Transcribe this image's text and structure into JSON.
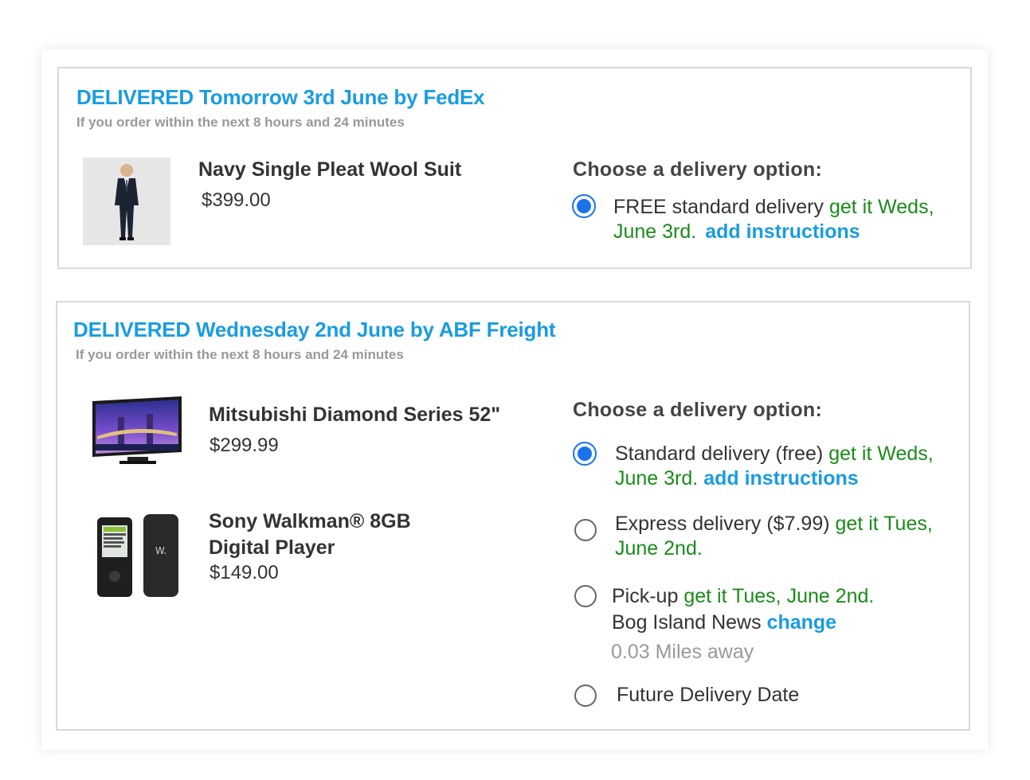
{
  "shipments": [
    {
      "heading": "DELIVERED Tomorrow 3rd June by FedEx",
      "subheading": "If you order within the next 8 hours and 24 minutes",
      "choose_label": "Choose a delivery option:",
      "products": [
        {
          "name": "Navy Single Pleat Wool Suit",
          "price": "$399.00"
        }
      ],
      "options": [
        {
          "selected": true,
          "label": "FREE standard delivery",
          "eta_line1": "get it Weds,",
          "eta_line2": "June 3rd.",
          "link": "add instructions"
        }
      ]
    },
    {
      "heading": "DELIVERED Wednesday 2nd June by ABF Freight",
      "subheading": "If you order within the next 8 hours and 24 minutes",
      "choose_label": "Choose a delivery option:",
      "products": [
        {
          "name": "Mitsubishi Diamond Series 52\"",
          "price": "$299.99"
        },
        {
          "name_line1": "Sony Walkman® 8GB",
          "name_line2": "Digital Player",
          "price": "$149.00"
        }
      ],
      "options": [
        {
          "selected": true,
          "label": "Standard delivery (free)",
          "eta_line1": "get it Weds,",
          "eta_line2": "June 3rd.",
          "link": "add instructions"
        },
        {
          "selected": false,
          "label": "Express delivery ($7.99)",
          "eta_line1": "get it Tues,",
          "eta_line2": "June 2nd."
        },
        {
          "selected": false,
          "label": "Pick-up",
          "eta_line1": "get it Tues, June 2nd.",
          "location": "Bog Island News",
          "link": "change",
          "distance": "0.03 Miles away"
        },
        {
          "selected": false,
          "label": "Future Delivery Date"
        }
      ]
    }
  ],
  "colors": {
    "accent": "#1a9ce0",
    "eta_green": "#1a8c1a",
    "radio_selected": "#1a73e8",
    "muted": "#999999"
  }
}
